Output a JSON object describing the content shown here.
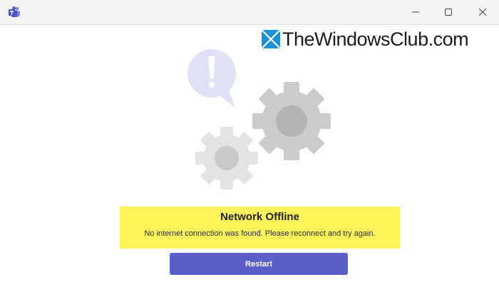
{
  "titlebar": {
    "app_icon": "teams-icon",
    "minimize_icon": "minimize-icon",
    "maximize_icon": "maximize-icon",
    "close_icon": "close-icon"
  },
  "watermark": {
    "text": "TheWindowsClub.com",
    "logo_icon": "windows-logo-icon"
  },
  "illustration": {
    "speech_bubble_icon": "exclamation-speech-bubble-icon",
    "large_gear_icon": "gear-icon",
    "small_gear_icon": "gear-icon"
  },
  "error": {
    "title": "Network Offline",
    "message": "No internet connection was found. Please reconnect and try again.",
    "highlight_color": "#fff45c"
  },
  "actions": {
    "restart_label": "Restart",
    "accent_color": "#5b5fc7"
  }
}
